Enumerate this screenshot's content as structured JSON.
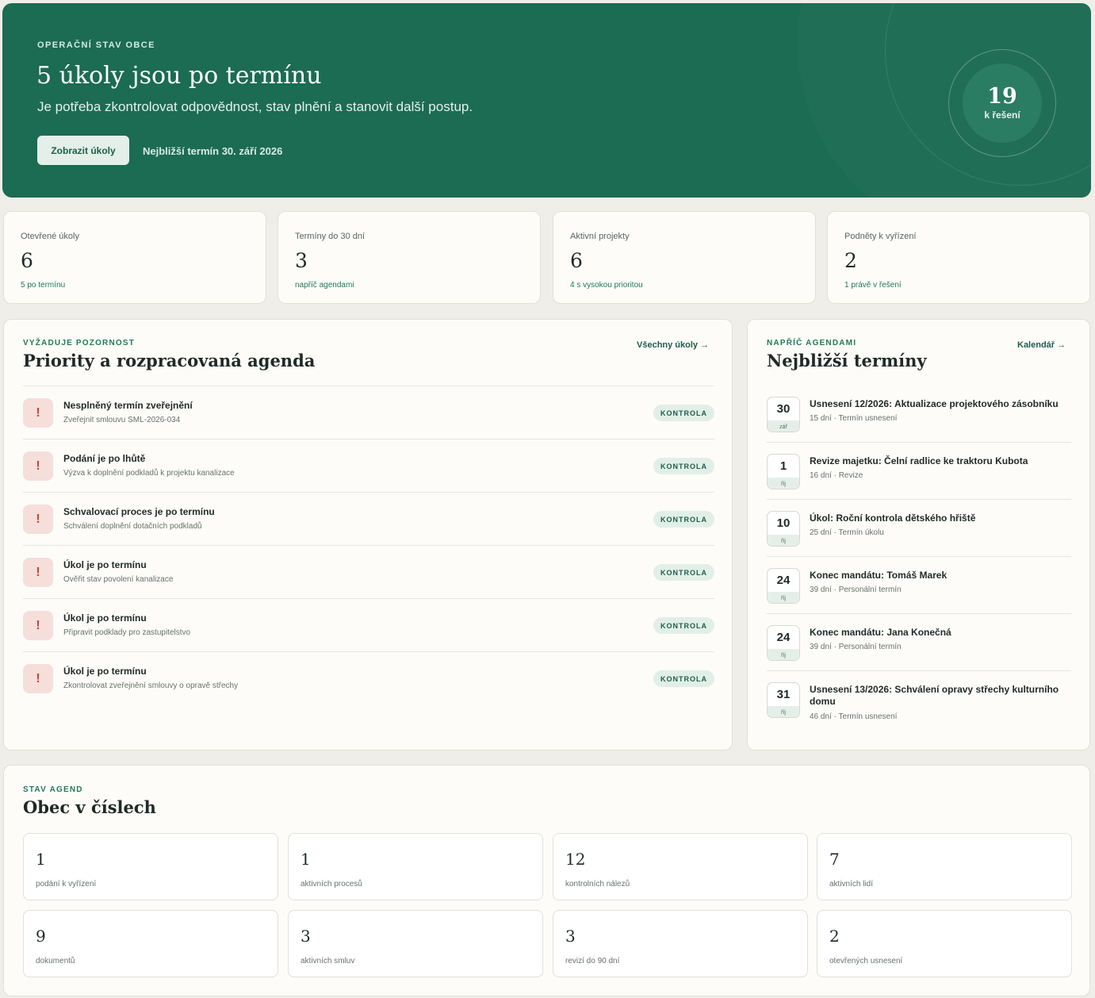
{
  "hero": {
    "eyebrow": "OPERAČNÍ STAV OBCE",
    "title": "5 úkoly jsou po termínu",
    "subtitle": "Je potřeba zkontrolovat odpovědnost, stav plnění a stanovit další postup.",
    "button_label": "Zobrazit úkoly",
    "next_deadline": "Nejbližší termín 30. září 2026",
    "badge_value": "19",
    "badge_label": "k řešení"
  },
  "stats": [
    {
      "label": "Otevřené úkoly",
      "value": "6",
      "note": "5 po termínu"
    },
    {
      "label": "Termíny do 30 dní",
      "value": "3",
      "note": "napříč agendami"
    },
    {
      "label": "Aktivní projekty",
      "value": "6",
      "note": "4 s vysokou prioritou"
    },
    {
      "label": "Podněty k vyřízení",
      "value": "2",
      "note": "1 právě v řešení"
    }
  ],
  "priorities": {
    "eyebrow": "VYŽADUJE POZORNOST",
    "title": "Priority a rozpracovaná agenda",
    "link": "Všechny úkoly →",
    "icon": "!",
    "items": [
      {
        "title": "Nesplněný termín zveřejnění",
        "subtitle": "Zveřejnit smlouvu SML-2026-034",
        "badge": "KONTROLA"
      },
      {
        "title": "Podání je po lhůtě",
        "subtitle": "Výzva k doplnění podkladů k projektu kanalizace",
        "badge": "KONTROLA"
      },
      {
        "title": "Schvalovací proces je po termínu",
        "subtitle": "Schválení doplnění dotačních podkladů",
        "badge": "KONTROLA"
      },
      {
        "title": "Úkol je po termínu",
        "subtitle": "Ověřit stav povolení kanalizace",
        "badge": "KONTROLA"
      },
      {
        "title": "Úkol je po termínu",
        "subtitle": "Připravit podklady pro zastupitelstvo",
        "badge": "KONTROLA"
      },
      {
        "title": "Úkol je po termínu",
        "subtitle": "Zkontrolovat zveřejnění smlouvy o opravě střechy",
        "badge": "KONTROLA"
      }
    ]
  },
  "deadlines": {
    "eyebrow": "NAPŘÍČ AGENDAMI",
    "title": "Nejbližší termíny",
    "link": "Kalendář →",
    "items": [
      {
        "day": "30",
        "month": "zář",
        "title": "Usnesení 12/2026: Aktualizace projektového zásobníku",
        "subtitle": "15 dní · Termín usnesení"
      },
      {
        "day": "1",
        "month": "říj",
        "title": "Revize majetku: Čelní radlice ke traktoru Kubota",
        "subtitle": "16 dní · Revize"
      },
      {
        "day": "10",
        "month": "říj",
        "title": "Úkol: Roční kontrola dětského hřiště",
        "subtitle": "25 dní · Termín úkolu"
      },
      {
        "day": "24",
        "month": "říj",
        "title": "Konec mandátu: Tomáš Marek",
        "subtitle": "39 dní · Personální termín"
      },
      {
        "day": "24",
        "month": "říj",
        "title": "Konec mandátu: Jana Konečná",
        "subtitle": "39 dní · Personální termín"
      },
      {
        "day": "31",
        "month": "říj",
        "title": "Usnesení 13/2026: Schválení opravy střechy kulturního domu",
        "subtitle": "46 dní · Termín usnesení"
      }
    ]
  },
  "numbers": {
    "eyebrow": "STAV AGEND",
    "title": "Obec v číslech",
    "items": [
      {
        "value": "1",
        "label": "podání k vyřízení"
      },
      {
        "value": "1",
        "label": "aktivních procesů"
      },
      {
        "value": "12",
        "label": "kontrolních nálezů"
      },
      {
        "value": "7",
        "label": "aktivních lidí"
      },
      {
        "value": "9",
        "label": "dokumentů"
      },
      {
        "value": "3",
        "label": "aktivních smluv"
      },
      {
        "value": "3",
        "label": "revizí do 90 dní"
      },
      {
        "value": "2",
        "label": "otevřených usnesení"
      }
    ]
  }
}
